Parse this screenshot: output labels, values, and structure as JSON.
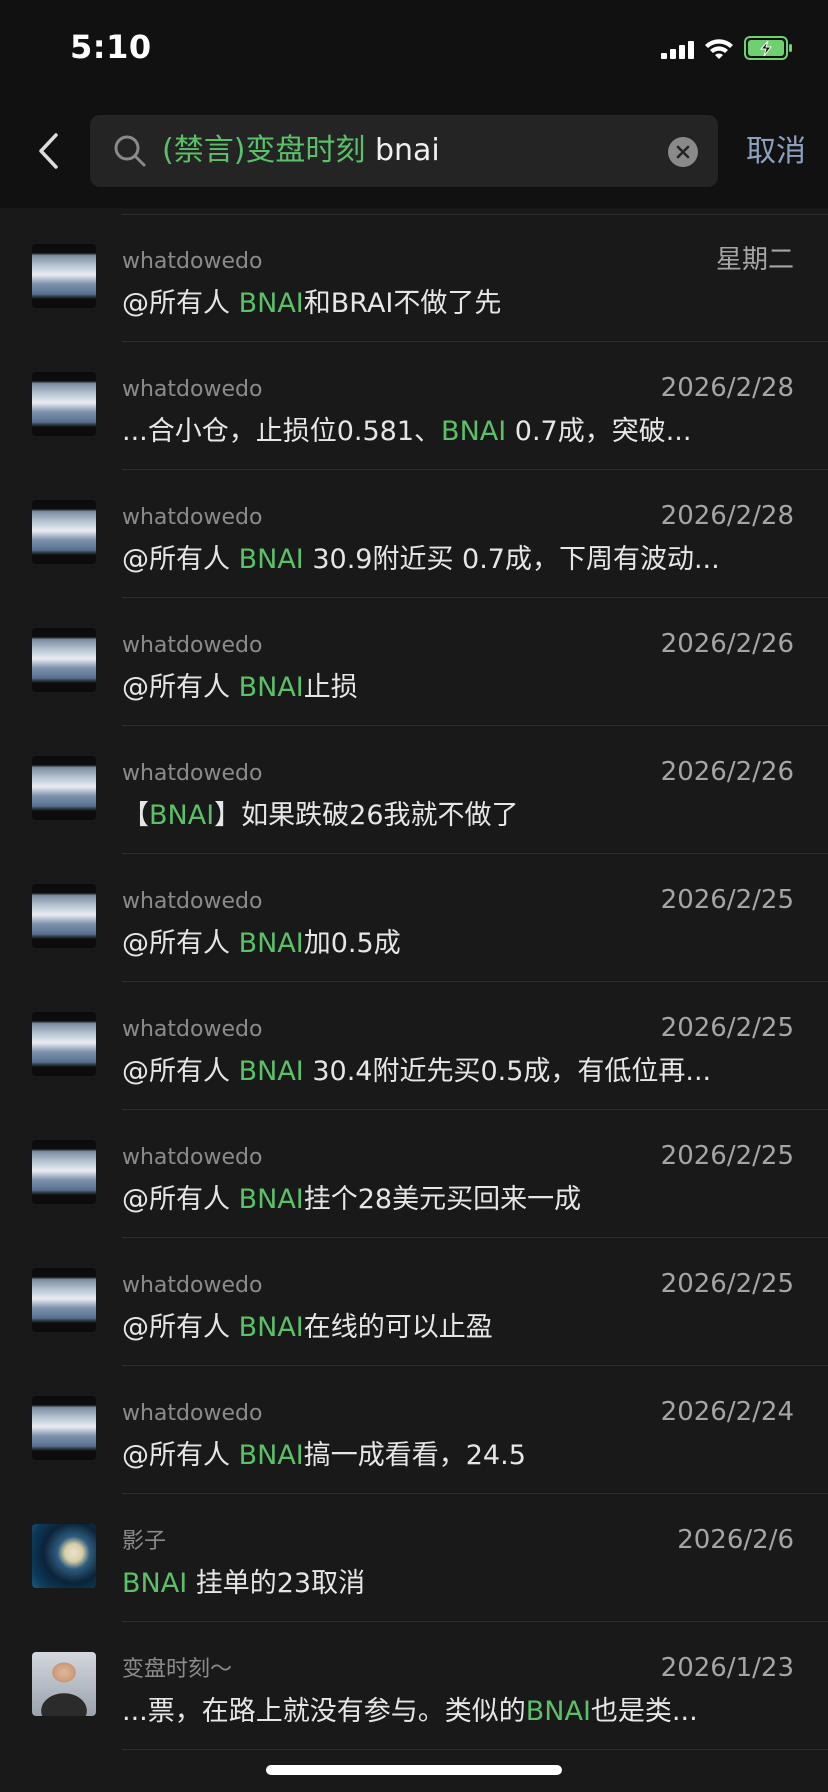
{
  "status_bar": {
    "time": "5:10"
  },
  "search": {
    "query_highlight": "(禁言)变盘时刻",
    "query_text": " bnai",
    "cancel_label": "取消"
  },
  "results": [
    {
      "avatar": "sky",
      "name": "whatdowedo",
      "date": "星期二",
      "segments": [
        {
          "t": "@所有人 "
        },
        {
          "t": "BNAI",
          "hl": true
        },
        {
          "t": "和BRAI不做了先"
        }
      ]
    },
    {
      "avatar": "sky",
      "name": "whatdowedo",
      "date": "2026/2/28",
      "segments": [
        {
          "t": "...合小仓，止损位0.581、"
        },
        {
          "t": "BNAI",
          "hl": true
        },
        {
          "t": "      0.7成，突破..."
        }
      ]
    },
    {
      "avatar": "sky",
      "name": "whatdowedo",
      "date": "2026/2/28",
      "segments": [
        {
          "t": "@所有人 "
        },
        {
          "t": "BNAI",
          "hl": true
        },
        {
          "t": " 30.9附近买 0.7成，下周有波动..."
        }
      ]
    },
    {
      "avatar": "sky",
      "name": "whatdowedo",
      "date": "2026/2/26",
      "segments": [
        {
          "t": "@所有人 "
        },
        {
          "t": "BNAI",
          "hl": true
        },
        {
          "t": "止损"
        }
      ]
    },
    {
      "avatar": "sky",
      "name": "whatdowedo",
      "date": "2026/2/26",
      "segments": [
        {
          "t": "【"
        },
        {
          "t": "BNAI",
          "hl": true
        },
        {
          "t": "】如果跌破26我就不做了"
        }
      ]
    },
    {
      "avatar": "sky",
      "name": "whatdowedo",
      "date": "2026/2/25",
      "segments": [
        {
          "t": "@所有人 "
        },
        {
          "t": "BNAI",
          "hl": true
        },
        {
          "t": "加0.5成"
        }
      ]
    },
    {
      "avatar": "sky",
      "name": "whatdowedo",
      "date": "2026/2/25",
      "segments": [
        {
          "t": "@所有人 "
        },
        {
          "t": "BNAI",
          "hl": true
        },
        {
          "t": " 30.4附近先买0.5成，有低位再..."
        }
      ]
    },
    {
      "avatar": "sky",
      "name": "whatdowedo",
      "date": "2026/2/25",
      "segments": [
        {
          "t": "@所有人 "
        },
        {
          "t": "BNAI",
          "hl": true
        },
        {
          "t": "挂个28美元买回来一成"
        }
      ]
    },
    {
      "avatar": "sky",
      "name": "whatdowedo",
      "date": "2026/2/25",
      "segments": [
        {
          "t": "@所有人 "
        },
        {
          "t": "BNAI",
          "hl": true
        },
        {
          "t": "在线的可以止盈"
        }
      ]
    },
    {
      "avatar": "sky",
      "name": "whatdowedo",
      "date": "2026/2/24",
      "segments": [
        {
          "t": "@所有人 "
        },
        {
          "t": "BNAI",
          "hl": true
        },
        {
          "t": "搞一成看看，24.5"
        }
      ]
    },
    {
      "avatar": "galaxy",
      "name": "影子",
      "date": "2026/2/6",
      "segments": [
        {
          "t": "BNAI",
          "hl": true
        },
        {
          "t": " 挂单的23取消"
        }
      ]
    },
    {
      "avatar": "person",
      "name": "变盘时刻～",
      "date": "2026/1/23",
      "segments": [
        {
          "t": "...票，在路上就没有参与。类似的"
        },
        {
          "t": "BNAI",
          "hl": true
        },
        {
          "t": "也是类..."
        }
      ]
    }
  ],
  "colors": {
    "background": "#191919",
    "header": "#111111",
    "highlight": "#5cc06a",
    "cancel": "#8da0c0"
  },
  "icons": [
    "back-chevron-icon",
    "search-icon",
    "clear-icon",
    "cellular-signal-icon",
    "wifi-icon",
    "battery-charging-icon"
  ]
}
